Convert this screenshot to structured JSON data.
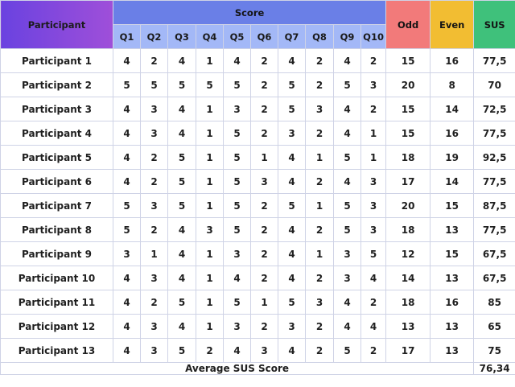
{
  "headers": {
    "participant": "Participant",
    "score": "Score",
    "questions": [
      "Q1",
      "Q2",
      "Q3",
      "Q4",
      "Q5",
      "Q6",
      "Q7",
      "Q8",
      "Q9",
      "Q10"
    ],
    "odd": "Odd",
    "even": "Even",
    "sus": "SUS"
  },
  "colors": {
    "participant_header": "#7d48de",
    "score_header": "#6a7fe7",
    "question_header": "#a3b8f7",
    "odd_header": "#f27a7a",
    "even_header": "#f2bd32",
    "sus_header": "#3fc17b"
  },
  "rows": [
    {
      "name": "Participant 1",
      "scores": [
        "4",
        "2",
        "4",
        "1",
        "4",
        "2",
        "4",
        "2",
        "4",
        "2"
      ],
      "odd": "15",
      "even": "16",
      "sus": "77,5"
    },
    {
      "name": "Participant 2",
      "scores": [
        "5",
        "5",
        "5",
        "5",
        "5",
        "2",
        "5",
        "2",
        "5",
        "3"
      ],
      "odd": "20",
      "even": "8",
      "sus": "70"
    },
    {
      "name": "Participant 3",
      "scores": [
        "4",
        "3",
        "4",
        "1",
        "3",
        "2",
        "5",
        "3",
        "4",
        "2"
      ],
      "odd": "15",
      "even": "14",
      "sus": "72,5"
    },
    {
      "name": "Participant 4",
      "scores": [
        "4",
        "3",
        "4",
        "1",
        "5",
        "2",
        "3",
        "2",
        "4",
        "1"
      ],
      "odd": "15",
      "even": "16",
      "sus": "77,5"
    },
    {
      "name": "Participant 5",
      "scores": [
        "4",
        "2",
        "5",
        "1",
        "5",
        "1",
        "4",
        "1",
        "5",
        "1"
      ],
      "odd": "18",
      "even": "19",
      "sus": "92,5"
    },
    {
      "name": "Participant 6",
      "scores": [
        "4",
        "2",
        "5",
        "1",
        "5",
        "3",
        "4",
        "2",
        "4",
        "3"
      ],
      "odd": "17",
      "even": "14",
      "sus": "77,5"
    },
    {
      "name": "Participant 7",
      "scores": [
        "5",
        "3",
        "5",
        "1",
        "5",
        "2",
        "5",
        "1",
        "5",
        "3"
      ],
      "odd": "20",
      "even": "15",
      "sus": "87,5"
    },
    {
      "name": "Participant 8",
      "scores": [
        "5",
        "2",
        "4",
        "3",
        "5",
        "2",
        "4",
        "2",
        "5",
        "3"
      ],
      "odd": "18",
      "even": "13",
      "sus": "77,5"
    },
    {
      "name": "Participant 9",
      "scores": [
        "3",
        "1",
        "4",
        "1",
        "3",
        "2",
        "4",
        "1",
        "3",
        "5"
      ],
      "odd": "12",
      "even": "15",
      "sus": "67,5"
    },
    {
      "name": "Participant 10",
      "scores": [
        "4",
        "3",
        "4",
        "1",
        "4",
        "2",
        "4",
        "2",
        "3",
        "4"
      ],
      "odd": "14",
      "even": "13",
      "sus": "67,5"
    },
    {
      "name": "Participant 11",
      "scores": [
        "4",
        "2",
        "5",
        "1",
        "5",
        "1",
        "5",
        "3",
        "4",
        "2"
      ],
      "odd": "18",
      "even": "16",
      "sus": "85"
    },
    {
      "name": "Participant 12",
      "scores": [
        "4",
        "3",
        "4",
        "1",
        "3",
        "2",
        "3",
        "2",
        "4",
        "4"
      ],
      "odd": "13",
      "even": "13",
      "sus": "65"
    },
    {
      "name": "Participant 13",
      "scores": [
        "4",
        "3",
        "5",
        "2",
        "4",
        "3",
        "4",
        "2",
        "5",
        "2"
      ],
      "odd": "17",
      "even": "13",
      "sus": "75"
    }
  ],
  "footer": {
    "label": "Average SUS Score",
    "value": "76,34"
  }
}
